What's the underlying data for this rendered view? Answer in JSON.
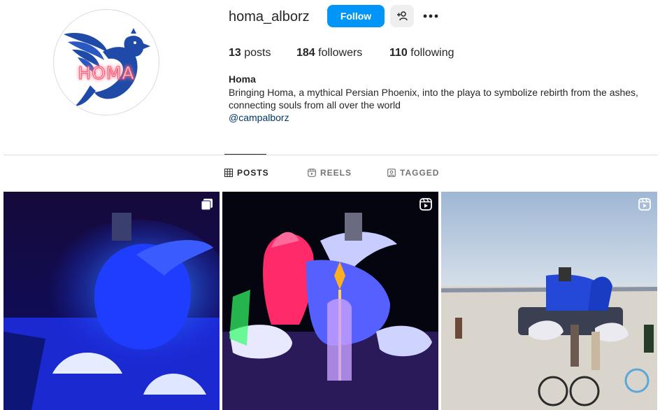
{
  "profile": {
    "username": "homa_alborz",
    "follow_label": "Follow",
    "avatar_text": "HOMA",
    "stats": {
      "posts_count": "13",
      "posts_label": "posts",
      "followers_count": "184",
      "followers_label": "followers",
      "following_count": "110",
      "following_label": "following"
    },
    "bio": {
      "name": "Homa",
      "text": "Bringing Homa, a mythical Persian Phoenix, into the playa to symbolize rebirth from the ashes, connecting souls from all over the world",
      "link": "@campalborz"
    }
  },
  "tabs": [
    {
      "label": "POSTS",
      "icon": "grid-icon",
      "active": true
    },
    {
      "label": "REELS",
      "icon": "reels-icon",
      "active": false
    },
    {
      "label": "TAGGED",
      "icon": "tagged-icon",
      "active": false
    }
  ],
  "posts": [
    {
      "badge": "carousel-icon",
      "description_color": "#1a3cff"
    },
    {
      "badge": "reels-icon",
      "description_color": "#ff2a6a"
    },
    {
      "badge": "reels-icon",
      "description_color": "#9fb7d4"
    }
  ],
  "colors": {
    "accent": "#0095f6",
    "link": "#00376b",
    "logo_blue": "#1f4aa8"
  }
}
